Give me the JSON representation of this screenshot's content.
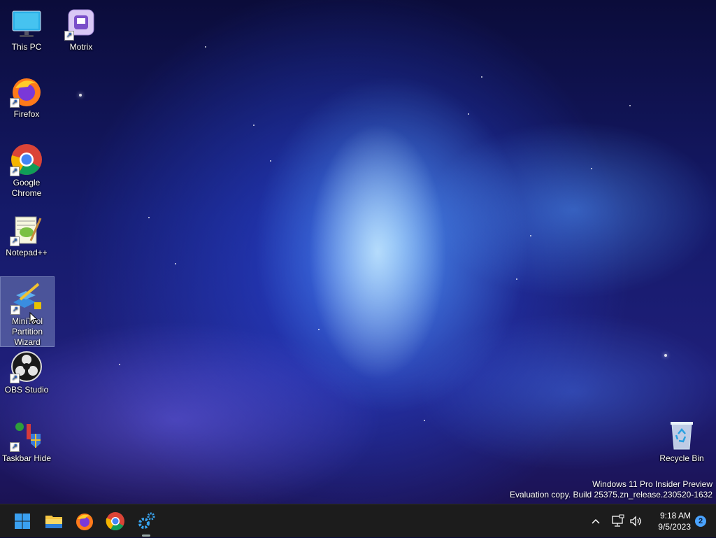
{
  "desktop": {
    "icons": [
      {
        "label": "This PC",
        "icon": "monitor-icon"
      },
      {
        "label": "Motrix",
        "icon": "motrix-icon"
      },
      {
        "label": "Firefox",
        "icon": "firefox-icon"
      },
      {
        "label": "Google Chrome",
        "icon": "chrome-icon"
      },
      {
        "label": "Notepad++",
        "icon": "notepadpp-icon"
      },
      {
        "label": "MiniTool Partition Wizard",
        "icon": "minitool-icon"
      },
      {
        "label": "OBS Studio",
        "icon": "obs-icon"
      },
      {
        "label": "Taskbar Hide",
        "icon": "taskbar-hide-icon"
      },
      {
        "label": "Recycle Bin",
        "icon": "recycle-bin-icon"
      }
    ],
    "selected_icon": "MiniTool Partition Wizard"
  },
  "watermark": {
    "line1": "Windows 11 Pro Insider Preview",
    "line2": "Evaluation copy. Build 25375.zn_release.230520-1632"
  },
  "taskbar": {
    "apps": [
      "start-button",
      "file-explorer",
      "firefox",
      "chrome",
      "settings"
    ],
    "tray": {
      "overflow_icon": "chevron-up-icon",
      "network_icon": "network-icon",
      "volume_icon": "speaker-icon"
    },
    "clock": {
      "time": "9:18 AM",
      "date": "9/5/2023"
    },
    "notification_count": "2"
  },
  "colors": {
    "taskbar_bg": "#1c1c1c",
    "badge": "#4aa3ff",
    "selection": "#aabee6"
  }
}
